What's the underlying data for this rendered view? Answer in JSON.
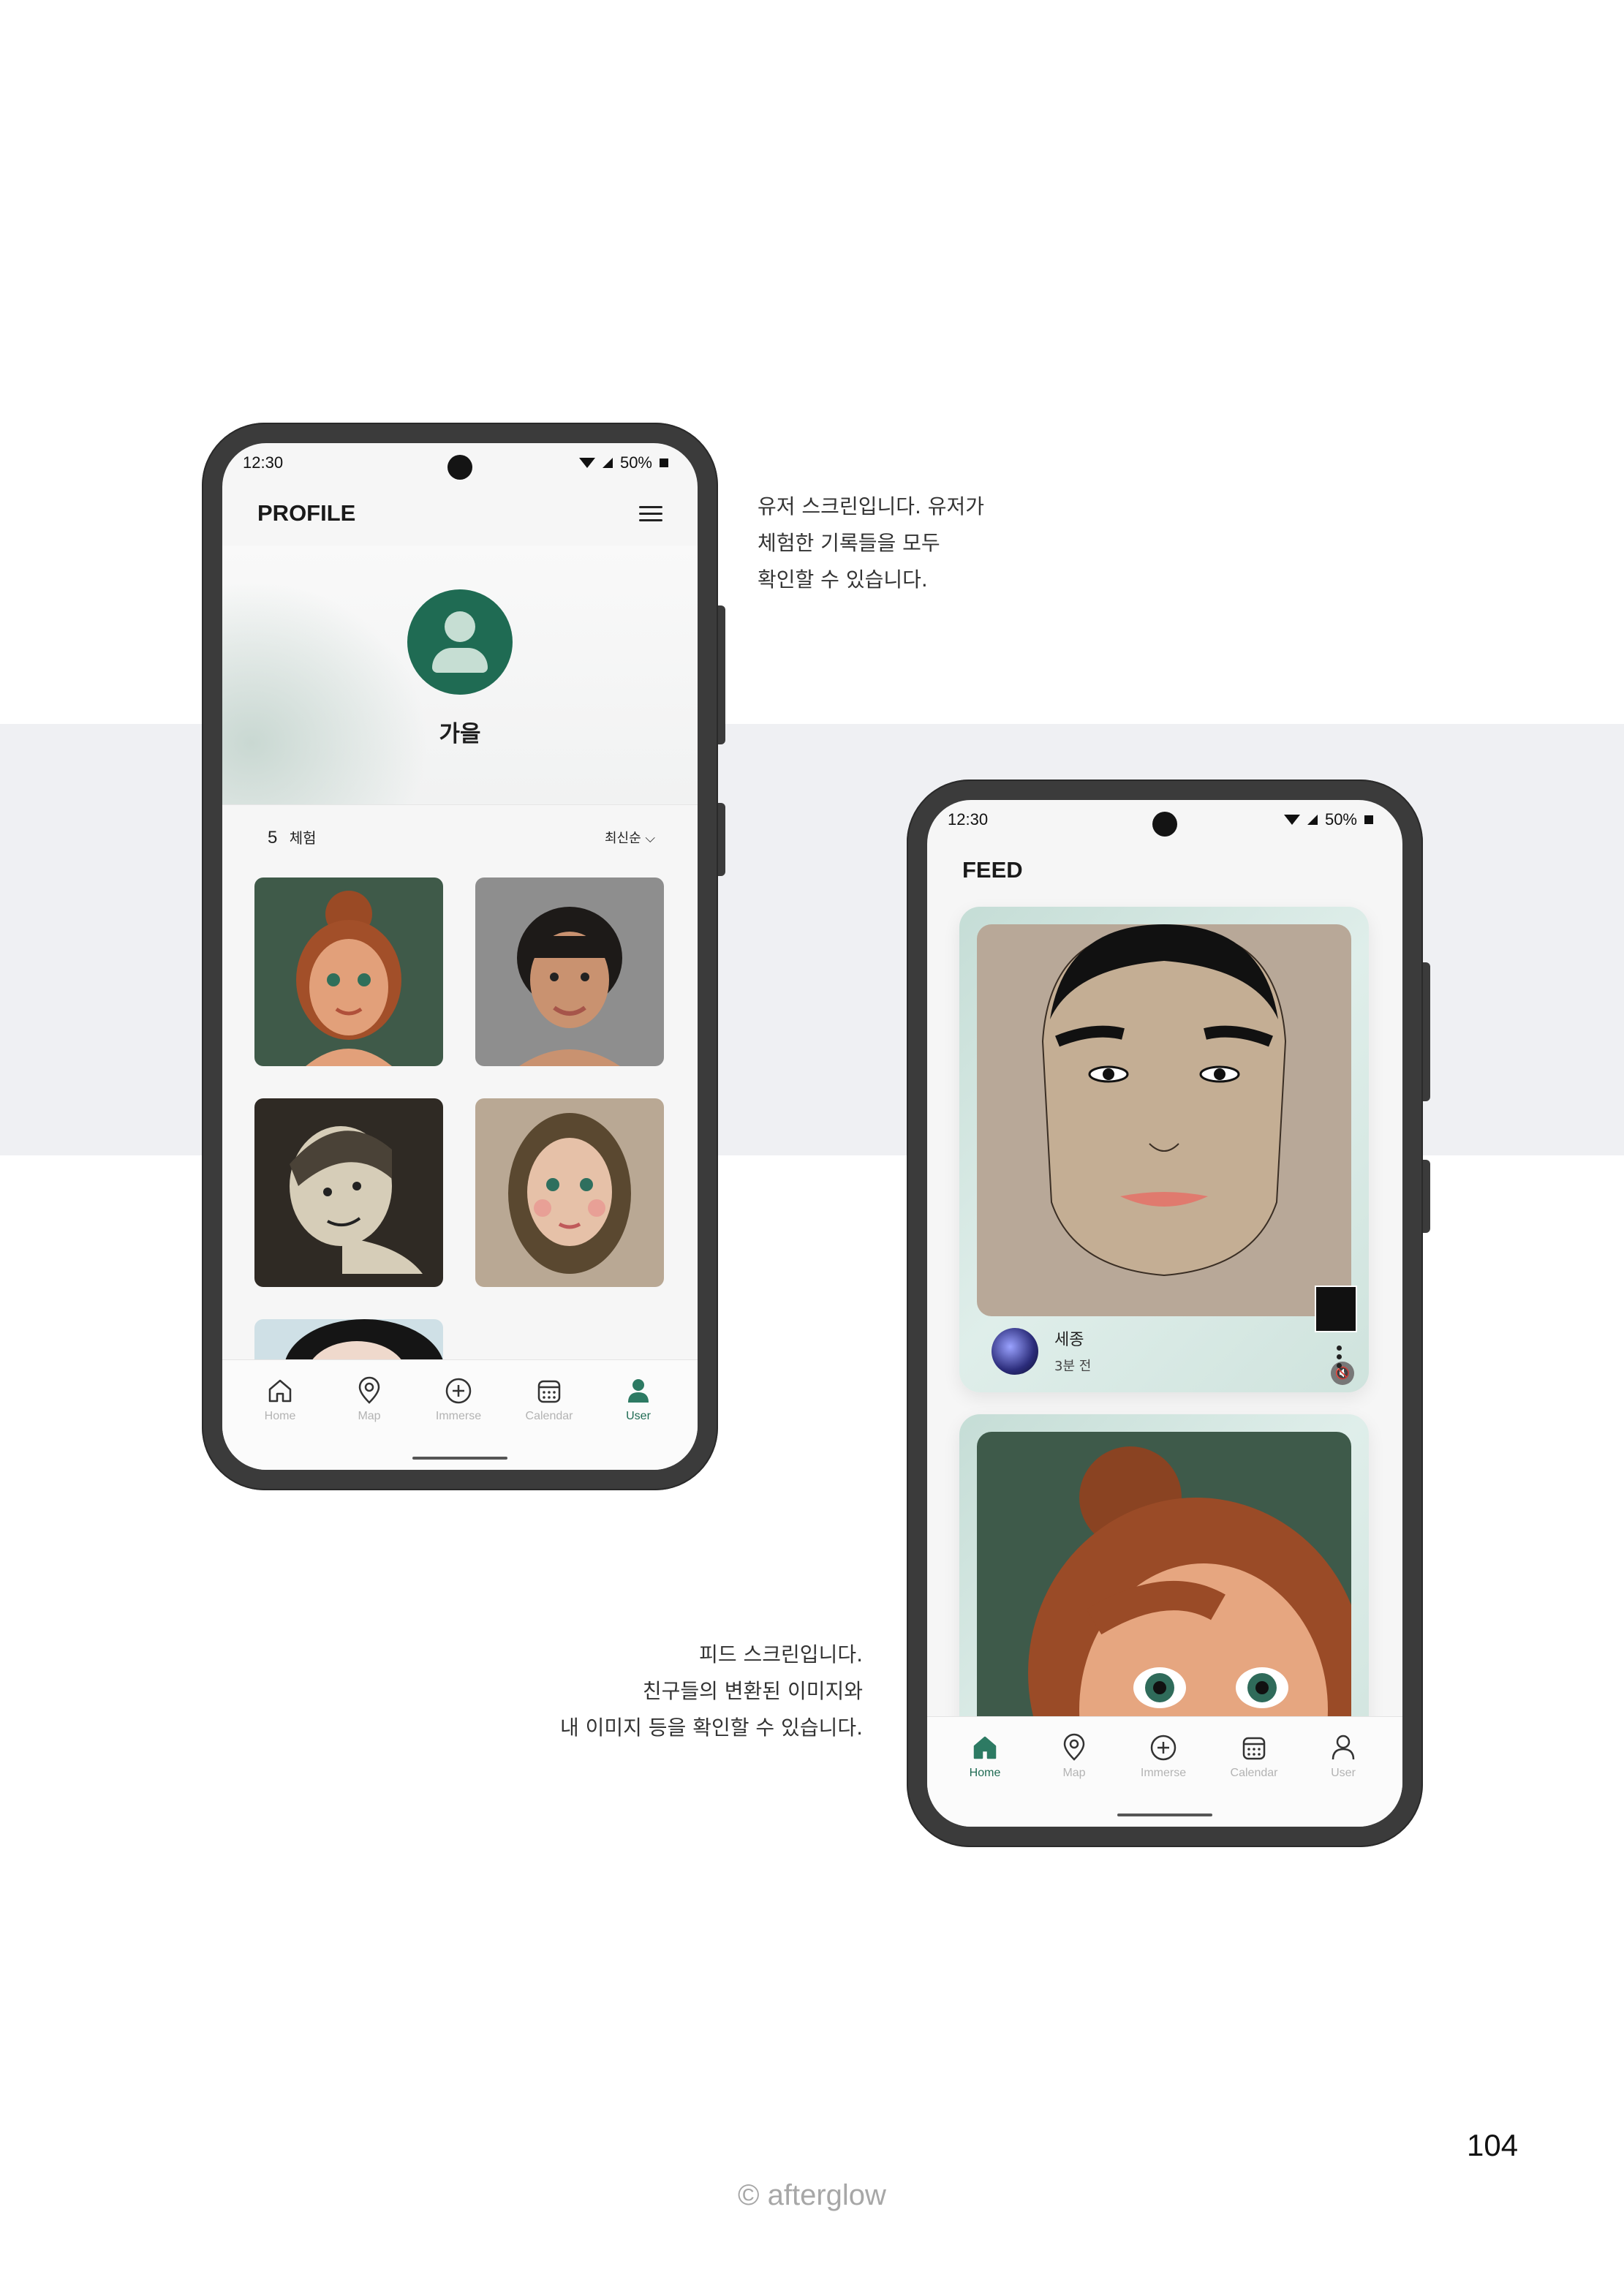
{
  "profile_screen": {
    "status": {
      "time": "12:30",
      "battery": "50%"
    },
    "title": "PROFILE",
    "user_name": "가을",
    "experience_count": "5",
    "experience_label": "체험",
    "sort_label": "최신순 ⌵"
  },
  "feed_screen": {
    "status": {
      "time": "12:30",
      "battery": "50%"
    },
    "title": "FEED",
    "post": {
      "user": "세종",
      "time": "3분 전"
    }
  },
  "tabs": [
    {
      "label": "Home",
      "icon": "home-icon"
    },
    {
      "label": "Map",
      "icon": "map-pin-icon"
    },
    {
      "label": "Immerse",
      "icon": "plus-circle-icon"
    },
    {
      "label": "Calendar",
      "icon": "calendar-icon"
    },
    {
      "label": "User",
      "icon": "user-icon"
    }
  ],
  "captions": {
    "user_screen": [
      "유저 스크린입니다. 유저가",
      "체험한 기록들을 모두",
      "확인할 수 있습니다."
    ],
    "feed_screen": [
      "피드 스크린입니다.",
      "친구들의 변환된 이미지와",
      "내 이미지 등을 확인할 수 있습니다."
    ]
  },
  "page_number": "104",
  "copyright": "© afterglow",
  "colors": {
    "accent": "#1f6b53",
    "frame": "#3b3b3b",
    "band": "#eff0f3"
  }
}
